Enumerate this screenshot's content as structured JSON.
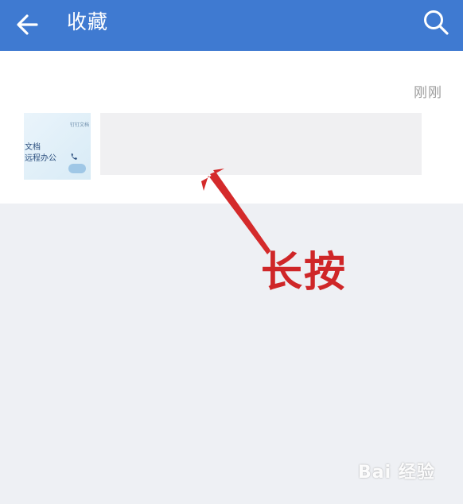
{
  "header": {
    "title": "收藏",
    "back_icon": "arrow-left-icon",
    "search_icon": "search-icon",
    "accent_color": "#3f7ad1"
  },
  "favorites": {
    "time_label": "刚刚",
    "items": [
      {
        "thumbnail": {
          "tag": "钉钉文档",
          "line1": "文档",
          "line2": "远程办公"
        }
      }
    ]
  },
  "annotation": {
    "label": "长按",
    "color": "#cf2628"
  },
  "watermark": {
    "text": "Bai 经验"
  }
}
